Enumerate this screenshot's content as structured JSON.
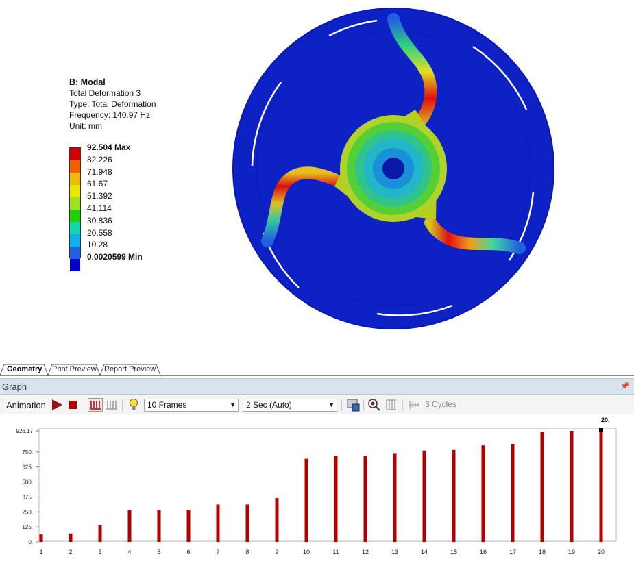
{
  "legend": {
    "title": "B: Modal",
    "result_name": "Total Deformation 3",
    "type": "Type: Total Deformation",
    "frequency": "Frequency: 140.97 Hz",
    "unit": "Unit: mm",
    "values": [
      "92.504 Max",
      "82.226",
      "71.948",
      "61.67",
      "51.392",
      "41.114",
      "30.836",
      "20.558",
      "10.28",
      "0.0020599 Min"
    ],
    "colors": [
      "#d40000",
      "#f06000",
      "#f0b800",
      "#e8e800",
      "#a0e020",
      "#20d000",
      "#10d8b0",
      "#10b0e8",
      "#2060e0",
      "#0000c8"
    ]
  },
  "model_colors": {
    "disc": "#0d21c4",
    "disc_edge": "#0a1aa8",
    "hub_outer": "#b7cf1c",
    "hub_mid": "#3ccf2f",
    "hub_inner": "#1fb9c8"
  },
  "tabs": [
    "Geometry",
    "Print Preview",
    "Report Preview"
  ],
  "graph": {
    "title": "Graph",
    "pin_icon": "pin-icon",
    "toolbar": {
      "animation_label": "Animation",
      "frames": "10 Frames",
      "duration": "2 Sec (Auto)",
      "cycles": "3 Cycles"
    }
  },
  "chart_data": {
    "type": "bar",
    "categories": [
      "1",
      "2",
      "3",
      "4",
      "5",
      "6",
      "7",
      "8",
      "9",
      "10",
      "11",
      "12",
      "13",
      "14",
      "15",
      "16",
      "17",
      "18",
      "19",
      "20"
    ],
    "values": [
      62,
      70,
      140,
      268,
      268,
      268,
      312,
      312,
      365,
      694,
      717,
      717,
      735,
      762,
      767,
      805,
      818,
      916,
      926,
      926.17
    ],
    "yticks": [
      "0.",
      "125.",
      "250.",
      "375.",
      "500.",
      "625.",
      "750.",
      "926.17"
    ],
    "ytick_values": [
      0,
      125,
      250,
      375,
      500,
      625,
      750,
      926.17
    ],
    "ylim": [
      0,
      926.17
    ],
    "highlight_label": "20.",
    "bar_color": "#b00000",
    "grid": false
  }
}
